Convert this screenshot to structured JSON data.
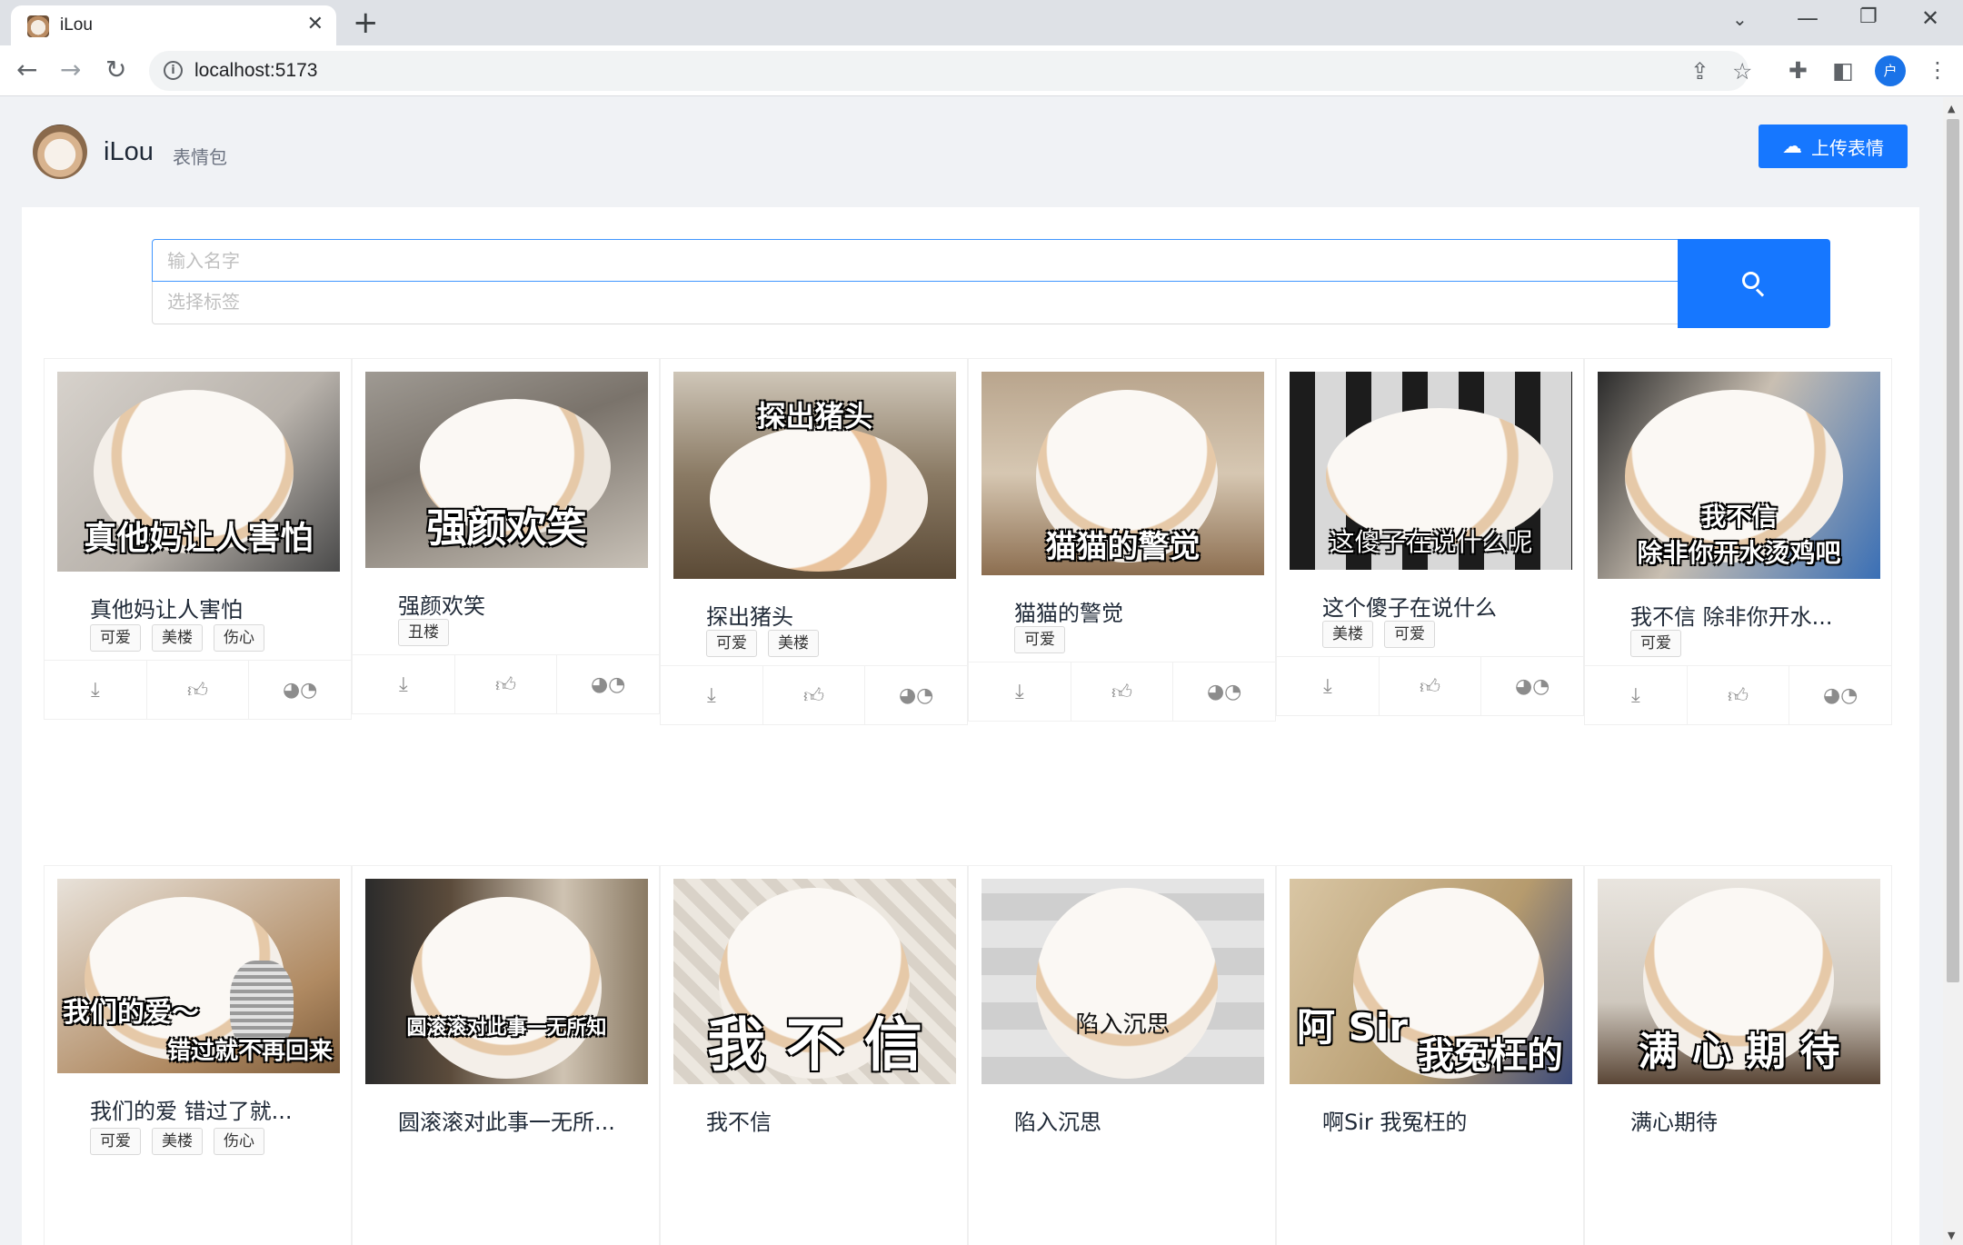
{
  "browser": {
    "tab_title": "iLou",
    "new_tab_symbol": "+",
    "url": "localhost:5173",
    "profile_initial": "户"
  },
  "site": {
    "title": "iLou",
    "subtitle": "表情包",
    "upload_label": "上传表情"
  },
  "search": {
    "name_placeholder": "输入名字",
    "tags_placeholder": "选择标签"
  },
  "icons": {
    "download": "download-icon",
    "like": "thumbs-up-icon",
    "share": "wechat-icon",
    "search": "search-icon",
    "upload": "cloud-upload-icon"
  },
  "colors": {
    "primary": "#1677ff",
    "page_bg": "#f0f2f5"
  },
  "cards": [
    {
      "title": "真他妈让人害怕",
      "caption": "真他妈让人害怕",
      "tags": [
        "可爱",
        "美楼",
        "伤心"
      ]
    },
    {
      "title": "强颜欢笑",
      "caption": "强颜欢笑",
      "tags": [
        "丑楼"
      ]
    },
    {
      "title": "探出猪头",
      "caption": "探出猪头",
      "tags": [
        "可爱",
        "美楼"
      ]
    },
    {
      "title": "猫猫的警觉",
      "caption": "猫猫的警觉",
      "tags": [
        "可爱"
      ]
    },
    {
      "title": "这个傻子在说什么",
      "caption": "这傻子在说什么呢",
      "tags": [
        "美楼",
        "可爱"
      ]
    },
    {
      "title": "我不信 除非你开水...",
      "caption": "我不信",
      "caption2": "除非你开水烫鸡吧",
      "tags": [
        "可爱"
      ]
    },
    {
      "title": "我们的爱 错过了就...",
      "caption": "我们的爱～",
      "caption2": "错过就不再回来",
      "tags": [
        "可爱",
        "美楼",
        "伤心"
      ]
    },
    {
      "title": "圆滚滚对此事一无所...",
      "caption": "圆滚滚对此事一无所知",
      "tags": []
    },
    {
      "title": "我不信",
      "caption": "我 不 信",
      "tags": []
    },
    {
      "title": "陷入沉思",
      "caption": "陷入沉思",
      "tags": []
    },
    {
      "title": "啊Sir 我冤枉的",
      "caption": "阿 Sir",
      "caption2": "我冤枉的",
      "tags": []
    },
    {
      "title": "满心期待",
      "caption": "满 心 期 待",
      "tags": []
    }
  ]
}
